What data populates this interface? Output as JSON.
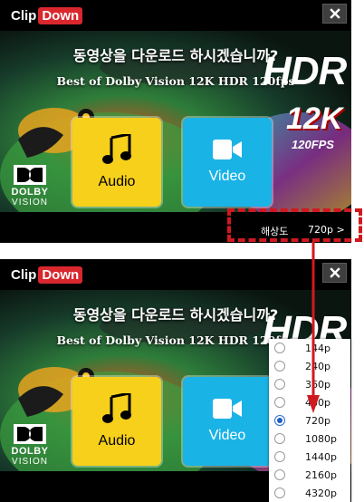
{
  "app": {
    "logo_clip": "Clip",
    "logo_down": "Down",
    "close_label": "close"
  },
  "dialog": {
    "question": "동영상을 다운로드 하시겠습니까?",
    "video_title": "Best of Dolby Vision 12K HDR 120fps",
    "audio_label": "Audio",
    "video_label": "Video"
  },
  "thumbnail": {
    "hdr": "HDR",
    "resolution_badge": "12K",
    "fps_badge": "120FPS",
    "dolby_word": "DOLBY",
    "dolby_sub": "VISION"
  },
  "resolution": {
    "label": "해상도",
    "value": "720p >"
  },
  "dropdown": {
    "selected_index": 4,
    "options": [
      "144p",
      "240p",
      "360p",
      "480p",
      "720p",
      "1080p",
      "1440p",
      "2160p",
      "4320p"
    ]
  },
  "colors": {
    "accent_red": "#d9272e",
    "audio_yellow": "#f6d01a",
    "video_blue": "#1ab3e6",
    "annotation_red": "#d0191f"
  },
  "icons": [
    "close-icon",
    "music-note-icon",
    "video-camera-icon",
    "dolby-logo-icon",
    "radio-icon"
  ]
}
